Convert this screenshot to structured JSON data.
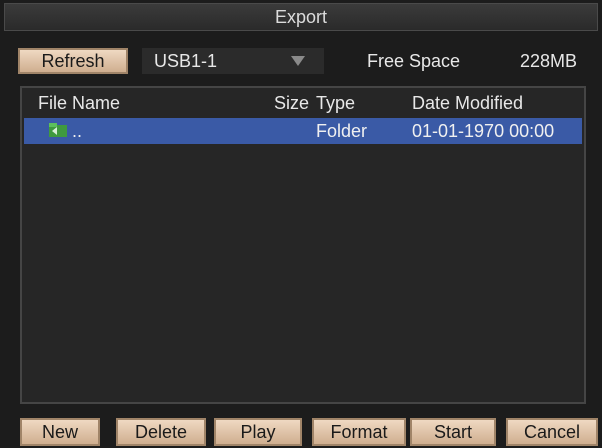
{
  "window": {
    "title": "Export"
  },
  "toolbar": {
    "refresh_label": "Refresh",
    "device_value": "USB1-1",
    "free_space_label": "Free Space",
    "free_space_value": "228MB"
  },
  "list": {
    "columns": [
      "File Name",
      "Size",
      "Type",
      "Date Modified"
    ],
    "rows": [
      {
        "name": "..",
        "size": "",
        "type": "Folder",
        "date": "01-01-1970 00:00",
        "icon": "folder-icon",
        "selected": true
      }
    ]
  },
  "buttons": [
    "New",
    "Delete",
    "Play",
    "Format",
    "Start",
    "Cancel"
  ],
  "colors": {
    "selection": "#3a5aa6",
    "button_face": "#dfc3a7",
    "background": "#1c1c1c"
  }
}
